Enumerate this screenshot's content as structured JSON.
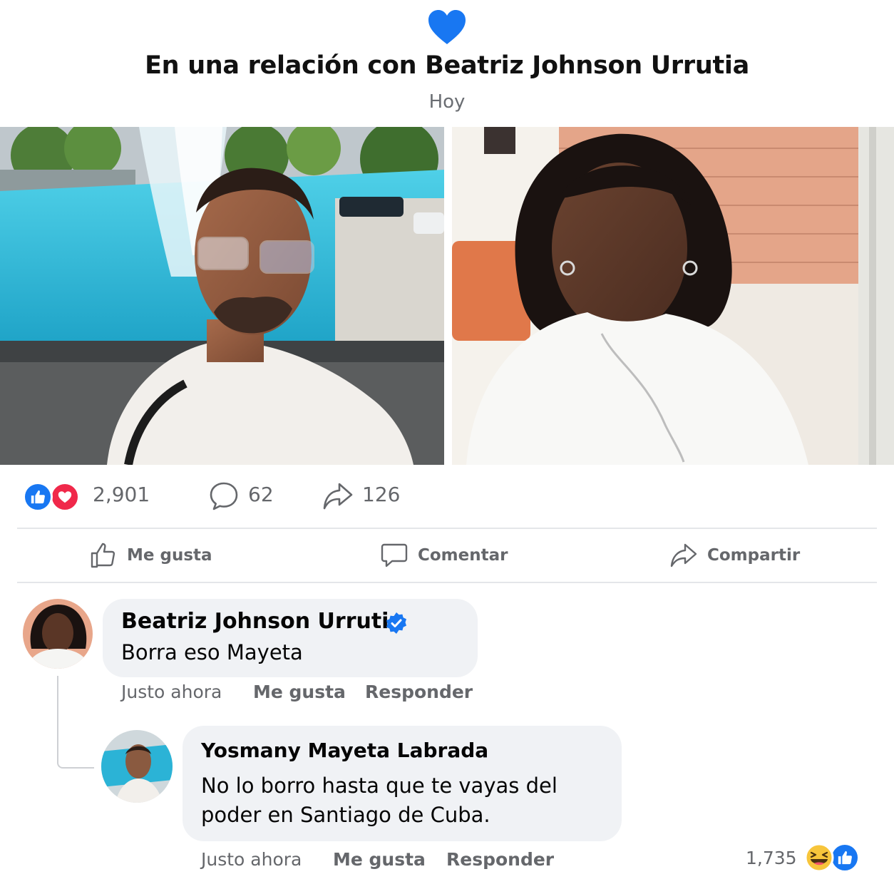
{
  "post": {
    "title": "En una relación con Beatriz Johnson Urrutia",
    "date": "Hoy"
  },
  "stats": {
    "reactions": "2,901",
    "comments": "62",
    "shares": "126"
  },
  "actions": {
    "like": "Me gusta",
    "comment": "Comentar",
    "share": "Compartir"
  },
  "comments": [
    {
      "author": "Beatriz Johnson Urrutia",
      "verified": true,
      "text": "Borra eso Mayeta",
      "time": "Justo ahora",
      "like": "Me gusta",
      "reply": "Responder"
    }
  ],
  "reply": {
    "author": "Yosmany Mayeta Labrada",
    "text": "No lo borro hasta que te vayas del poder en Santiago de Cuba.",
    "time": "Justo ahora",
    "like": "Me gusta",
    "reply": "Responder",
    "reactions": "1,735"
  },
  "colors": {
    "like_blue": "#1877f2",
    "love_red": "#f0284a",
    "bubble_bg": "#f0f2f5",
    "muted_text": "#65676b"
  },
  "icons": [
    "heart-icon",
    "like-reaction-icon",
    "love-reaction-icon",
    "comment-icon",
    "share-icon",
    "thumbs-up-icon",
    "verified-badge-icon",
    "haha-reaction-icon"
  ]
}
